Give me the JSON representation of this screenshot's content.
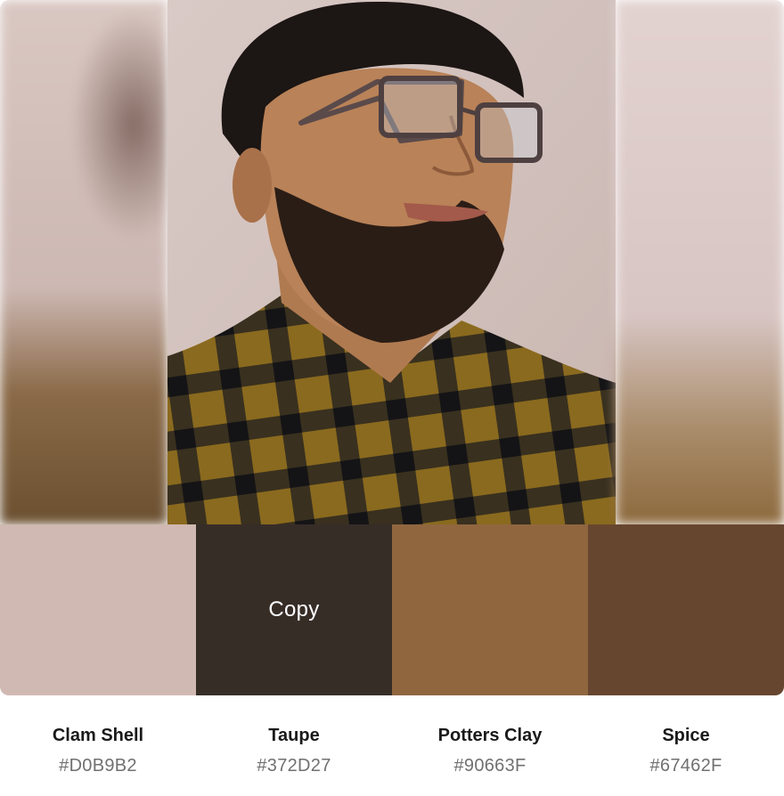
{
  "copy_hover_label": "Copy",
  "palette": [
    {
      "name": "Clam Shell",
      "hex": "#D0B9B2",
      "color": "#D0B9B2"
    },
    {
      "name": "Taupe",
      "hex": "#372D27",
      "color": "#372D27"
    },
    {
      "name": "Potters Clay",
      "hex": "#90663F",
      "color": "#90663F"
    },
    {
      "name": "Spice",
      "hex": "#67462F",
      "color": "#67462F"
    }
  ]
}
